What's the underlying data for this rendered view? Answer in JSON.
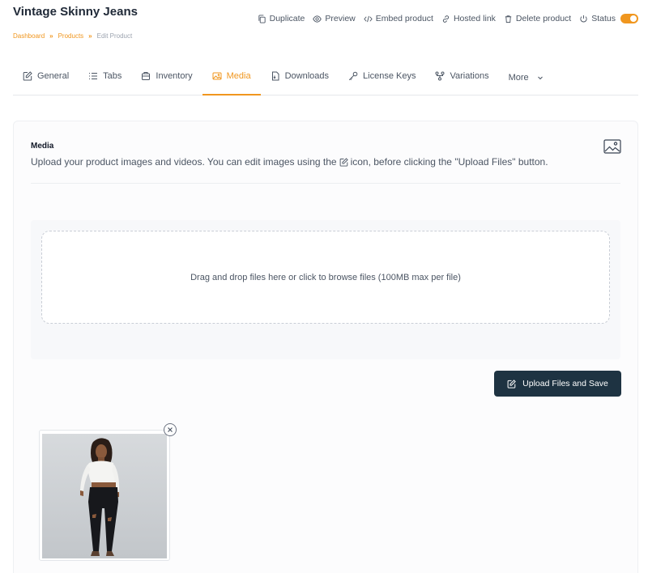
{
  "product": {
    "title": "Vintage Skinny Jeans"
  },
  "breadcrumb": {
    "items": [
      "Dashboard",
      "Products",
      "Edit Product"
    ],
    "separator": "»"
  },
  "actions": {
    "duplicate": "Duplicate",
    "preview": "Preview",
    "embed": "Embed product",
    "hosted_link": "Hosted link",
    "delete": "Delete product",
    "status": "Status",
    "status_on": true
  },
  "tabs": [
    {
      "label": "General",
      "icon": "edit-icon",
      "active": false
    },
    {
      "label": "Tabs",
      "icon": "list-icon",
      "active": false
    },
    {
      "label": "Inventory",
      "icon": "inventory-icon",
      "active": false
    },
    {
      "label": "Media",
      "icon": "image-icon",
      "active": true
    },
    {
      "label": "Downloads",
      "icon": "file-icon",
      "active": false
    },
    {
      "label": "License Keys",
      "icon": "key-icon",
      "active": false
    },
    {
      "label": "Variations",
      "icon": "variations-icon",
      "active": false
    },
    {
      "label": "More",
      "icon": "chevron-down-icon",
      "active": false
    }
  ],
  "media": {
    "heading": "Media",
    "description_before": "Upload your product images and videos. You can edit images using the",
    "description_after": "icon, before clicking the \"Upload Files\" button.",
    "dropzone_text": "Drag and drop files here or click to browse files (100MB max per file)",
    "upload_button": "Upload Files and Save"
  },
  "colors": {
    "accent": "#f0961e",
    "button_dark": "#1e3342"
  }
}
